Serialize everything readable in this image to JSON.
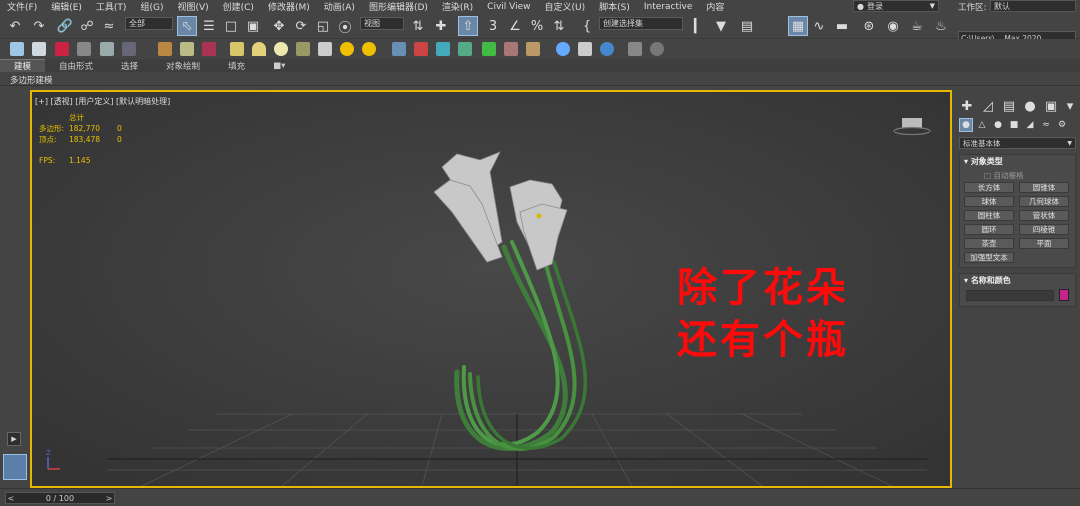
{
  "menu": {
    "items": [
      "文件(F)",
      "编辑(E)",
      "工具(T)",
      "组(G)",
      "视图(V)",
      "创建(C)",
      "修改器(M)",
      "动画(A)",
      "图形编辑器(D)",
      "渲染(R)",
      "Civil View",
      "自定义(U)",
      "脚本(S)",
      "Interactive",
      "内容"
    ],
    "login": "登录",
    "workspace_label": "工作区:",
    "workspace_value": "默认"
  },
  "toolbar": {
    "filter_value": "全部",
    "view_value": "视图",
    "selection_set": "创建选择集",
    "project_path": "C:\\Users\\... Max 2020"
  },
  "ribbon": {
    "tabs": [
      "建模",
      "自由形式",
      "选择",
      "对象绘制",
      "填充"
    ],
    "sub_label": "多边形建模"
  },
  "viewport": {
    "label": "[+] [透视] [用户定义] [默认明暗处理]",
    "stats_header": "总计",
    "poly_label": "多边形:",
    "poly_value": "182,770",
    "poly_sel": "0",
    "vert_label": "顶点:",
    "vert_value": "183,478",
    "vert_sel": "0",
    "fps_label": "FPS:",
    "fps_value": "1.145",
    "overlay_line1": "除了花朵",
    "overlay_line2": "还有个瓶"
  },
  "panel": {
    "category_dropdown": "标准基本体",
    "object_type_title": "对象类型",
    "autogrid": "自动栅格",
    "buttons": [
      "长方体",
      "圆锥体",
      "球体",
      "几何球体",
      "圆柱体",
      "管状体",
      "圆环",
      "四棱锥",
      "茶壶",
      "平面",
      "加强型文本"
    ],
    "name_color_title": "名称和颜色",
    "object_color": "#c4248c"
  },
  "timeline": {
    "value": "0 / 100"
  },
  "colors": {
    "viewport_border": "#e6b800",
    "overlay_text": "#ff0a0a",
    "stats_text": "#e8c000"
  }
}
